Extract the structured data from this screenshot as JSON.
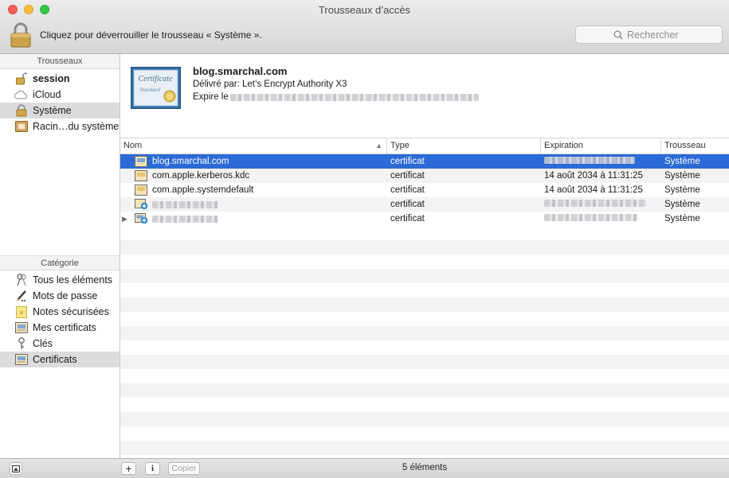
{
  "window": {
    "title": "Trousseaux d’accès"
  },
  "toolbar": {
    "lock_message": "Cliquez pour déverrouiller le trousseau « Système ».",
    "search_placeholder": "Rechercher"
  },
  "sidebar": {
    "keychains_header": "Trousseaux",
    "keychains": [
      {
        "label": "session",
        "icon": "unlocked-padlock-icon",
        "bold": true
      },
      {
        "label": "iCloud",
        "icon": "cloud-icon"
      },
      {
        "label": "Système",
        "icon": "locked-padlock-icon",
        "selected": true
      },
      {
        "label": "Racin…du système",
        "icon": "cabinet-icon"
      }
    ],
    "category_header": "Catégorie",
    "categories": [
      {
        "label": "Tous les éléments",
        "icon": "keys-icon"
      },
      {
        "label": "Mots de passe",
        "icon": "pencil-icon"
      },
      {
        "label": "Notes sécurisées",
        "icon": "note-icon"
      },
      {
        "label": "Mes certificats",
        "icon": "certificate-icon"
      },
      {
        "label": "Clés",
        "icon": "key-icon"
      },
      {
        "label": "Certificats",
        "icon": "certificate-icon",
        "selected": true
      }
    ]
  },
  "detail": {
    "name": "blog.smarchal.com",
    "issuer": "Délivré par: Let’s Encrypt Authority X3",
    "expire_prefix": "Expire le",
    "badge_line1": "Certificate",
    "badge_line2": "Standard"
  },
  "table": {
    "columns": [
      "Nom",
      "Type",
      "Expiration",
      "Trousseau"
    ],
    "rows": [
      {
        "name": "blog.smarchal.com",
        "type": "certificat",
        "expiration": "",
        "keychain": "Système",
        "selected": true
      },
      {
        "name": "com.apple.kerberos.kdc",
        "type": "certificat",
        "expiration": "14 août 2034 à 11:31:25",
        "keychain": "Système"
      },
      {
        "name": "com.apple.systemdefault",
        "type": "certificat",
        "expiration": "14 août 2034 à 11:31:25",
        "keychain": "Système"
      },
      {
        "name": "",
        "type": "certificat",
        "expiration": "",
        "keychain": "Système"
      },
      {
        "name": "",
        "type": "certificat",
        "expiration": "",
        "keychain": "Système"
      }
    ]
  },
  "bottom": {
    "add_label": "+",
    "info_label": "i",
    "copy_label": "Copier",
    "count": "5 éléments"
  },
  "colors": {
    "selection": "#2c6bd7",
    "sidebar_selection": "#dcdcdc",
    "stripe": "#f3f3f3"
  }
}
